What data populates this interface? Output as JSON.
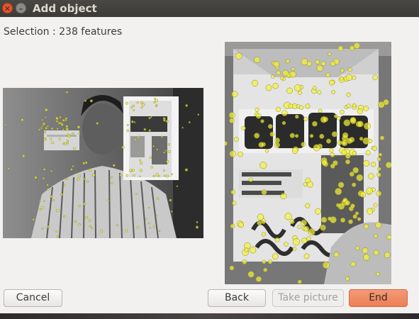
{
  "window": {
    "title": "Add object"
  },
  "selection": {
    "label": "Selection : 238 features"
  },
  "images": {
    "left": {
      "name": "camera-preview-with-features"
    },
    "right": {
      "name": "selected-object-with-features"
    }
  },
  "buttons": {
    "cancel": "Cancel",
    "back": "Back",
    "take_picture": "Take picture",
    "end": "End"
  },
  "colors": {
    "feature_point": "#f5f23a",
    "end_button": "#ee7f55",
    "titlebar": "#3c3b37"
  }
}
